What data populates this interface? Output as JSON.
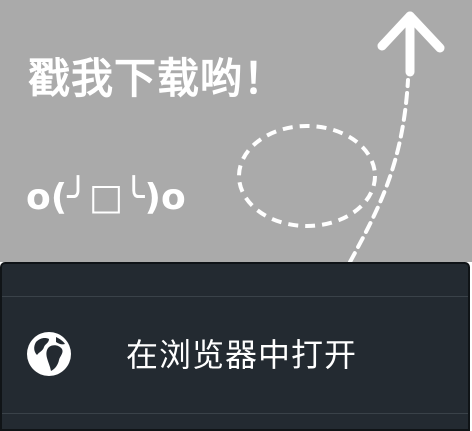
{
  "hint": {
    "title": "戳我下载哟！",
    "emoticon": "o(╯□╰)o",
    "arrow_icon": "dashed-loop-arrow-up",
    "overlay_color": "#aaaaaa",
    "text_color": "#ffffff"
  },
  "sheet": {
    "background_color": "#232a31",
    "items": [
      {
        "icon": "globe-icon",
        "label": "在浏览器中打开"
      }
    ]
  }
}
